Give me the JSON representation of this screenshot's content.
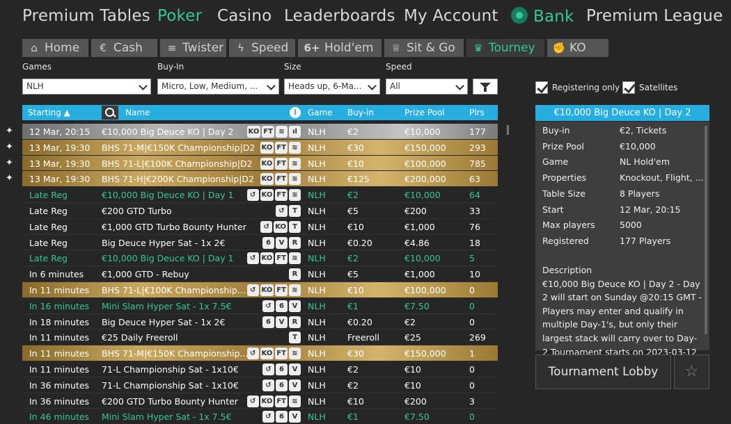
{
  "topnav": {
    "premium_tables": "Premium Tables",
    "poker": "Poker",
    "casino": "Casino",
    "leaderboards": "Leaderboards",
    "my_account": "My Account",
    "bank": "Bank",
    "premium_league": "Premium League"
  },
  "subtabs": {
    "home": "Home",
    "cash": "Cash",
    "twister": "Twister",
    "speed": "Speed",
    "sixplus_icon": "6+",
    "holdem": "Hold'em",
    "sitgo": "Sit & Go",
    "tourney": "Tourney",
    "ko": "KO"
  },
  "filters": {
    "games_label": "Games",
    "games_value": "NLH",
    "buyin_label": "Buy-In",
    "buyin_value": "Micro, Low, Medium, ...",
    "size_label": "Size",
    "size_value": "Heads up, 6-Ma...",
    "speed_label": "Speed",
    "speed_value": "All",
    "registering_only": "Registering only",
    "satellites": "Satellites"
  },
  "table": {
    "columns": {
      "starting": "Starting ▲",
      "info_icon": "i",
      "name": "Name",
      "game": "Game",
      "buyin": "Buy-in",
      "prize": "Prize Pool",
      "plrs": "Plrs"
    },
    "rows": [
      {
        "start": "12 Mar, 20:15",
        "name": "€10,000 Big Deuce KO | Day 2",
        "badges": [
          "KO",
          "FT",
          "≋",
          "ıl"
        ],
        "game": "NLH",
        "buyin": "€2",
        "prize": "€10,000",
        "plrs": "177",
        "style": "silver",
        "pinned": true
      },
      {
        "start": "13 Mar, 19:30",
        "name": "BHS 71-M|€150K Championship|D2",
        "badges": [
          "KO",
          "FT",
          "≋"
        ],
        "game": "NLH",
        "buyin": "€30",
        "prize": "€150,000",
        "plrs": "293",
        "style": "gold",
        "pinned": true
      },
      {
        "start": "13 Mar, 19:30",
        "name": "BHS 71-L|€100K Championship|D2",
        "badges": [
          "KO",
          "FT",
          "≋"
        ],
        "game": "NLH",
        "buyin": "€10",
        "prize": "€100,000",
        "plrs": "785",
        "style": "gold",
        "pinned": true
      },
      {
        "start": "13 Mar, 19:30",
        "name": "BHS 71-H|€200K Championship|D2",
        "badges": [
          "KO",
          "FT",
          "≋"
        ],
        "game": "NLH",
        "buyin": "€125",
        "prize": "€200,000",
        "plrs": "63",
        "style": "gold",
        "pinned": true
      },
      {
        "start": "Late Reg",
        "name": "€10,000 Big Deuce KO | Day 1",
        "badges": [
          "↺",
          "KO",
          "FT",
          "≋"
        ],
        "game": "NLH",
        "buyin": "€2",
        "prize": "€10,000",
        "plrs": "64",
        "style": "green",
        "pinned": false
      },
      {
        "start": "Late Reg",
        "name": "€200 GTD Turbo",
        "badges": [
          "↺",
          "T"
        ],
        "game": "NLH",
        "buyin": "€5",
        "prize": "€200",
        "plrs": "33",
        "style": "normal",
        "pinned": false
      },
      {
        "start": "Late Reg",
        "name": "€1,000 GTD Turbo Bounty Hunter",
        "badges": [
          "↺",
          "KO",
          "T"
        ],
        "game": "NLH",
        "buyin": "€10",
        "prize": "€1,000",
        "plrs": "76",
        "style": "normal",
        "pinned": false
      },
      {
        "start": "Late Reg",
        "name": "Big Deuce Hyper Sat - 1x 2€",
        "badges": [
          "6",
          "V",
          "R"
        ],
        "game": "NLH",
        "buyin": "€0.20",
        "prize": "€4.86",
        "plrs": "18",
        "style": "normal",
        "pinned": false
      },
      {
        "start": "Late Reg",
        "name": "€10,000 Big Deuce KO | Day 1",
        "badges": [
          "↺",
          "KO",
          "FT",
          "≋"
        ],
        "game": "NLH",
        "buyin": "€2",
        "prize": "€10,000",
        "plrs": "5",
        "style": "green",
        "pinned": false
      },
      {
        "start": "In 6 minutes",
        "name": "€1,000 GTD - Rebuy",
        "badges": [
          "R"
        ],
        "game": "NLH",
        "buyin": "€5",
        "prize": "€1,000",
        "plrs": "10",
        "style": "normal",
        "pinned": false
      },
      {
        "start": "In 11 minutes",
        "name": "BHS 71-L|€100K Championship...",
        "badges": [
          "↺",
          "KO",
          "FT",
          "≋"
        ],
        "game": "NLH",
        "buyin": "€10",
        "prize": "€100,000",
        "plrs": "0",
        "style": "gold",
        "pinned": false
      },
      {
        "start": "In 16 minutes",
        "name": "Mini Slam Hyper Sat - 1x 7.5€",
        "badges": [
          "↺",
          "6",
          "V"
        ],
        "game": "NLH",
        "buyin": "€1",
        "prize": "€7.50",
        "plrs": "0",
        "style": "green",
        "pinned": false
      },
      {
        "start": "In 18 minutes",
        "name": "Big Deuce Hyper Sat - 1x 2€",
        "badges": [
          "6",
          "V",
          "R"
        ],
        "game": "NLH",
        "buyin": "€0.20",
        "prize": "€2",
        "plrs": "0",
        "style": "normal",
        "pinned": false
      },
      {
        "start": "In 11 minutes",
        "name": "€25 Daily Freeroll",
        "badges": [
          "T"
        ],
        "game": "NLH",
        "buyin": "Freeroll",
        "prize": "€25",
        "plrs": "269",
        "style": "normal",
        "pinned": false
      },
      {
        "start": "In 11 minutes",
        "name": "BHS 71-M|€150K Championship...",
        "badges": [
          "↺",
          "KO",
          "FT",
          "≋"
        ],
        "game": "NLH",
        "buyin": "€30",
        "prize": "€150,000",
        "plrs": "1",
        "style": "gold",
        "pinned": false
      },
      {
        "start": "In 11 minutes",
        "name": "71-L Championship Sat - 1x10€",
        "badges": [
          "↺",
          "6",
          "V"
        ],
        "game": "NLH",
        "buyin": "€2",
        "prize": "€10",
        "plrs": "0",
        "style": "normal",
        "pinned": false
      },
      {
        "start": "In 36 minutes",
        "name": "71-L Championship Sat - 1x10€",
        "badges": [
          "↺",
          "6",
          "V"
        ],
        "game": "NLH",
        "buyin": "€2",
        "prize": "€10",
        "plrs": "0",
        "style": "normal",
        "pinned": false
      },
      {
        "start": "In 36 minutes",
        "name": "€200 GTD Turbo Bounty Hunter",
        "badges": [
          "↺",
          "KO",
          "FT",
          "≋"
        ],
        "game": "NLH",
        "buyin": "€10",
        "prize": "€200",
        "plrs": "3",
        "style": "normal",
        "pinned": false
      },
      {
        "start": "In 46 minutes",
        "name": "Mini Slam Hyper Sat - 1x 7.5€",
        "badges": [
          "↺",
          "6",
          "V"
        ],
        "game": "NLH",
        "buyin": "€1",
        "prize": "€7.50",
        "plrs": "0",
        "style": "green",
        "pinned": false
      }
    ]
  },
  "detail": {
    "title": "€10,000 Big Deuce KO | Day 2",
    "fields": [
      {
        "label": "Buy-in",
        "value": "€2, Tickets"
      },
      {
        "label": "Prize Pool",
        "value": "€10,000"
      },
      {
        "label": "Game",
        "value": "NL Hold'em"
      },
      {
        "label": "Properties",
        "value": "Knockout, Flight, ..."
      },
      {
        "label": "Table Size",
        "value": "8 Players"
      },
      {
        "label": "Start",
        "value": "12 Mar, 20:15"
      },
      {
        "label": "Max players",
        "value": "5000"
      },
      {
        "label": "Registered",
        "value": "177 Players"
      }
    ],
    "description_label": "Description",
    "description": "€10,000 Big Deuce KO | Day 2 - Day 2 will start on Sunday @20:15 GMT - Players may enter and qualify in multiple Day-1's, but only their largest stack will carry over to Day-2 Tournament starts on 2023-03-12",
    "lobby_button": "Tournament Lobby",
    "favorite_icon": "☆"
  },
  "colors": {
    "accent_green": "#35c79a",
    "header_blue": "#27aee0",
    "background": "#262626"
  }
}
